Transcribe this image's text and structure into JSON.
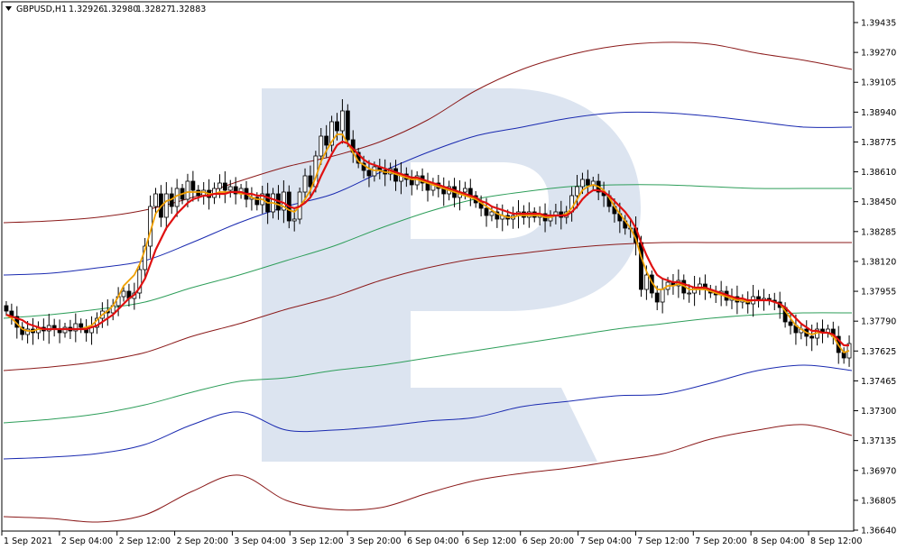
{
  "header": {
    "symbol": "GBPUSD,H1",
    "open": "1.32926",
    "high": "1.32980",
    "low": "1.32827",
    "close": "1.32883"
  },
  "colors": {
    "background": "#ffffff",
    "frame": "#000000",
    "watermark": "#dce4f0",
    "candle_up": "#ffffff",
    "candle_down": "#000000",
    "ma_fast": "#f0a000",
    "ma_slow": "#e01010",
    "band_dark_red": "#8b1a1a",
    "band_blue": "#1a2ab0",
    "band_green": "#2e9e5a"
  },
  "chart_data": {
    "type": "candlestick",
    "grid": false,
    "y_axis": {
      "position": "right",
      "ylim": [
        1.3658,
        1.3951
      ],
      "ticks": [
        "1.39435",
        "1.39270",
        "1.39105",
        "1.38940",
        "1.38775",
        "1.38610",
        "1.38450",
        "1.38285",
        "1.38120",
        "1.37955",
        "1.37790",
        "1.37625",
        "1.37465",
        "1.37300",
        "1.37135",
        "1.36970",
        "1.36805",
        "1.36640"
      ]
    },
    "x_axis": {
      "ticks": [
        "1 Sep 2021",
        "2 Sep 04:00",
        "2 Sep 12:00",
        "2 Sep 20:00",
        "3 Sep 04:00",
        "3 Sep 12:00",
        "3 Sep 20:00",
        "6 Sep 04:00",
        "6 Sep 12:00",
        "6 Sep 20:00",
        "7 Sep 04:00",
        "7 Sep 12:00",
        "7 Sep 20:00",
        "8 Sep 04:00",
        "8 Sep 12:00"
      ]
    },
    "candles_close": [
      1.378,
      1.3777,
      1.3771,
      1.3767,
      1.377,
      1.3768,
      1.3771,
      1.3769,
      1.3772,
      1.377,
      1.3768,
      1.3771,
      1.3769,
      1.3773,
      1.3771,
      1.3768,
      1.3771,
      1.3776,
      1.378,
      1.3779,
      1.3783,
      1.3788,
      1.3791,
      1.3787,
      1.379,
      1.3803,
      1.3816,
      1.3838,
      1.3845,
      1.3832,
      1.3845,
      1.3838,
      1.3848,
      1.3842,
      1.3852,
      1.3847,
      1.3844,
      1.3847,
      1.3843,
      1.3848,
      1.3851,
      1.3847,
      1.3849,
      1.3845,
      1.3848,
      1.3842,
      1.3843,
      1.3839,
      1.3845,
      1.3835,
      1.3845,
      1.3836,
      1.3846,
      1.383,
      1.3831,
      1.3846,
      1.3855,
      1.3849,
      1.3866,
      1.3877,
      1.3872,
      1.3885,
      1.388,
      1.3891,
      1.3875,
      1.3868,
      1.3862,
      1.3858,
      1.3855,
      1.386,
      1.3858,
      1.3856,
      1.3859,
      1.3852,
      1.3856,
      1.3853,
      1.385,
      1.3855,
      1.3851,
      1.3847,
      1.3851,
      1.3848,
      1.3845,
      1.3849,
      1.3843,
      1.3846,
      1.3848,
      1.3844,
      1.384,
      1.3837,
      1.3833,
      1.3835,
      1.3831,
      1.3833,
      1.3831,
      1.3833,
      1.3835,
      1.3832,
      1.3835,
      1.3832,
      1.3834,
      1.383,
      1.3833,
      1.3835,
      1.3832,
      1.3835,
      1.3844,
      1.3849,
      1.3853,
      1.385,
      1.3852,
      1.3846,
      1.3844,
      1.3838,
      1.3834,
      1.383,
      1.3826,
      1.3826,
      1.3818,
      1.3792,
      1.38,
      1.379,
      1.3785,
      1.3792,
      1.3796,
      1.3794,
      1.3797,
      1.379,
      1.379,
      1.3793,
      1.3795,
      1.3792,
      1.379,
      1.3789,
      1.3791,
      1.3786,
      1.3788,
      1.3785,
      1.3786,
      1.3784,
      1.3788,
      1.3786,
      1.3787,
      1.3786,
      1.3785,
      1.3782,
      1.3774,
      1.3772,
      1.3768,
      1.377,
      1.3766,
      1.3765,
      1.377,
      1.3768,
      1.377,
      1.3766,
      1.3757,
      1.3754,
      1.3762
    ],
    "series": [
      {
        "name": "MA fast",
        "color": "#f0a000",
        "values": [
          1.3778,
          1.3776,
          1.3773,
          1.377,
          1.3769,
          1.3769,
          1.377,
          1.377,
          1.377,
          1.377,
          1.377,
          1.377,
          1.377,
          1.377,
          1.377,
          1.3771,
          1.3772,
          1.3775,
          1.3778,
          1.378,
          1.3783,
          1.3788,
          1.3794,
          1.3797,
          1.38,
          1.3806,
          1.3814,
          1.3824,
          1.3834,
          1.3838,
          1.3841,
          1.3842,
          1.3844,
          1.3845,
          1.3846,
          1.3846,
          1.3846,
          1.3846,
          1.3845,
          1.3845,
          1.3846,
          1.3846,
          1.3846,
          1.3846,
          1.3845,
          1.3845,
          1.3843,
          1.3842,
          1.3842,
          1.384,
          1.384,
          1.3839,
          1.3838,
          1.3836,
          1.3835,
          1.3838,
          1.3842,
          1.3847,
          1.3854,
          1.3863,
          1.3869,
          1.3874,
          1.3878,
          1.3878,
          1.3873,
          1.3868,
          1.3863,
          1.3861,
          1.3859,
          1.3858,
          1.3858,
          1.3857,
          1.3857,
          1.3856,
          1.3855,
          1.3854,
          1.3853,
          1.3853,
          1.3852,
          1.3851,
          1.385,
          1.3849,
          1.3848,
          1.3847,
          1.3846,
          1.3845,
          1.3844,
          1.3843,
          1.3842,
          1.384,
          1.3838,
          1.3836,
          1.3834,
          1.3833,
          1.3832,
          1.3832,
          1.3833,
          1.3833,
          1.3833,
          1.3833,
          1.3833,
          1.3832,
          1.3832,
          1.3833,
          1.3833,
          1.3834,
          1.3837,
          1.3842,
          1.3847,
          1.3849,
          1.385,
          1.3849,
          1.3847,
          1.3843,
          1.3838,
          1.3834,
          1.383,
          1.3826,
          1.382,
          1.381,
          1.3802,
          1.3796,
          1.3792,
          1.3792,
          1.3794,
          1.3794,
          1.3795,
          1.3794,
          1.3792,
          1.3792,
          1.3792,
          1.3792,
          1.3791,
          1.379,
          1.3789,
          1.3788,
          1.3787,
          1.3786,
          1.3786,
          1.3785,
          1.3786,
          1.3786,
          1.3786,
          1.3786,
          1.3785,
          1.3784,
          1.378,
          1.3776,
          1.3772,
          1.377,
          1.3768,
          1.3767,
          1.3768,
          1.3768,
          1.3768,
          1.3766,
          1.3761,
          1.3757,
          1.3758
        ]
      },
      {
        "name": "MA slow",
        "color": "#e01010",
        "values": [
          1.3778,
          1.3777,
          1.3776,
          1.3775,
          1.3773,
          1.3772,
          1.3771,
          1.377,
          1.377,
          1.377,
          1.377,
          1.377,
          1.377,
          1.377,
          1.377,
          1.377,
          1.3771,
          1.3772,
          1.3774,
          1.3776,
          1.3778,
          1.3781,
          1.3784,
          1.3787,
          1.3789,
          1.3793,
          1.3798,
          1.3806,
          1.3814,
          1.382,
          1.3826,
          1.383,
          1.3834,
          1.3837,
          1.384,
          1.3842,
          1.3843,
          1.3844,
          1.3844,
          1.3845,
          1.3845,
          1.3845,
          1.3846,
          1.3846,
          1.3846,
          1.3845,
          1.3845,
          1.3844,
          1.3844,
          1.3843,
          1.3842,
          1.3841,
          1.384,
          1.3838,
          1.3837,
          1.3838,
          1.384,
          1.3843,
          1.3848,
          1.3855,
          1.3861,
          1.3867,
          1.3872,
          1.3874,
          1.3873,
          1.387,
          1.3867,
          1.3864,
          1.3862,
          1.3861,
          1.386,
          1.3859,
          1.3858,
          1.3857,
          1.3856,
          1.3855,
          1.3854,
          1.3854,
          1.3853,
          1.3852,
          1.3851,
          1.385,
          1.3849,
          1.3848,
          1.3847,
          1.3846,
          1.3845,
          1.3844,
          1.3843,
          1.3841,
          1.384,
          1.3838,
          1.3837,
          1.3836,
          1.3835,
          1.3834,
          1.3834,
          1.3834,
          1.3834,
          1.3834,
          1.3834,
          1.3833,
          1.3833,
          1.3833,
          1.3833,
          1.3833,
          1.3835,
          1.3838,
          1.3842,
          1.3845,
          1.3847,
          1.3847,
          1.3846,
          1.3844,
          1.3841,
          1.3838,
          1.3835,
          1.3831,
          1.3826,
          1.3818,
          1.3811,
          1.3805,
          1.38,
          1.3798,
          1.3797,
          1.3796,
          1.3796,
          1.3795,
          1.3794,
          1.3793,
          1.3793,
          1.3793,
          1.3792,
          1.3791,
          1.379,
          1.3789,
          1.3788,
          1.3787,
          1.3787,
          1.3786,
          1.3786,
          1.3786,
          1.3786,
          1.3786,
          1.3785,
          1.3784,
          1.3782,
          1.3779,
          1.3776,
          1.3773,
          1.3771,
          1.3769,
          1.3769,
          1.3768,
          1.3768,
          1.3767,
          1.3764,
          1.3761,
          1.3761
        ]
      },
      {
        "color": "#8b1a1a",
        "values": [
          1.3829,
          1.383,
          1.3832,
          1.3836,
          1.3843,
          1.3852,
          1.386,
          1.3866,
          1.3874,
          1.3886,
          1.3902,
          1.3914,
          1.3922,
          1.3927,
          1.3929,
          1.3928,
          1.3923,
          1.3919,
          1.3914
        ]
      },
      {
        "color": "#1a2ab0",
        "values": [
          1.38,
          1.3801,
          1.3804,
          1.3808,
          1.3818,
          1.3829,
          1.3838,
          1.3845,
          1.3857,
          1.3868,
          1.3877,
          1.3882,
          1.3887,
          1.389,
          1.389,
          1.3888,
          1.3885,
          1.3882,
          1.3882
        ]
      },
      {
        "color": "#2e9e5a",
        "values": [
          1.3776,
          1.3778,
          1.3781,
          1.3785,
          1.3793,
          1.38,
          1.3808,
          1.3816,
          1.3826,
          1.3835,
          1.3842,
          1.3846,
          1.3849,
          1.385,
          1.385,
          1.3849,
          1.3848,
          1.3848,
          1.3848
        ]
      },
      {
        "color": "#8b1a1a",
        "values": [
          1.3747,
          1.3749,
          1.3752,
          1.3757,
          1.3766,
          1.3773,
          1.3781,
          1.3788,
          1.3797,
          1.3804,
          1.3809,
          1.3812,
          1.3815,
          1.3817,
          1.3818,
          1.3818,
          1.3818,
          1.3818,
          1.3818
        ]
      },
      {
        "color": "#2e9e5a",
        "values": [
          1.3718,
          1.372,
          1.3723,
          1.3728,
          1.3735,
          1.3741,
          1.3743,
          1.3747,
          1.375,
          1.3754,
          1.3758,
          1.3762,
          1.3766,
          1.377,
          1.3773,
          1.3776,
          1.3778,
          1.3779,
          1.3779
        ]
      },
      {
        "color": "#1a2ab0",
        "values": [
          1.3698,
          1.3699,
          1.3701,
          1.3706,
          1.3717,
          1.3724,
          1.3714,
          1.3714,
          1.3716,
          1.3719,
          1.3721,
          1.3727,
          1.373,
          1.3733,
          1.3734,
          1.374,
          1.3747,
          1.375,
          1.3747
        ]
      },
      {
        "color": "#8b1a1a",
        "values": [
          1.3666,
          1.3665,
          1.3663,
          1.3667,
          1.368,
          1.3689,
          1.3675,
          1.367,
          1.3671,
          1.3679,
          1.3686,
          1.369,
          1.3693,
          1.3697,
          1.3701,
          1.3709,
          1.3714,
          1.3717,
          1.3711
        ]
      }
    ]
  }
}
